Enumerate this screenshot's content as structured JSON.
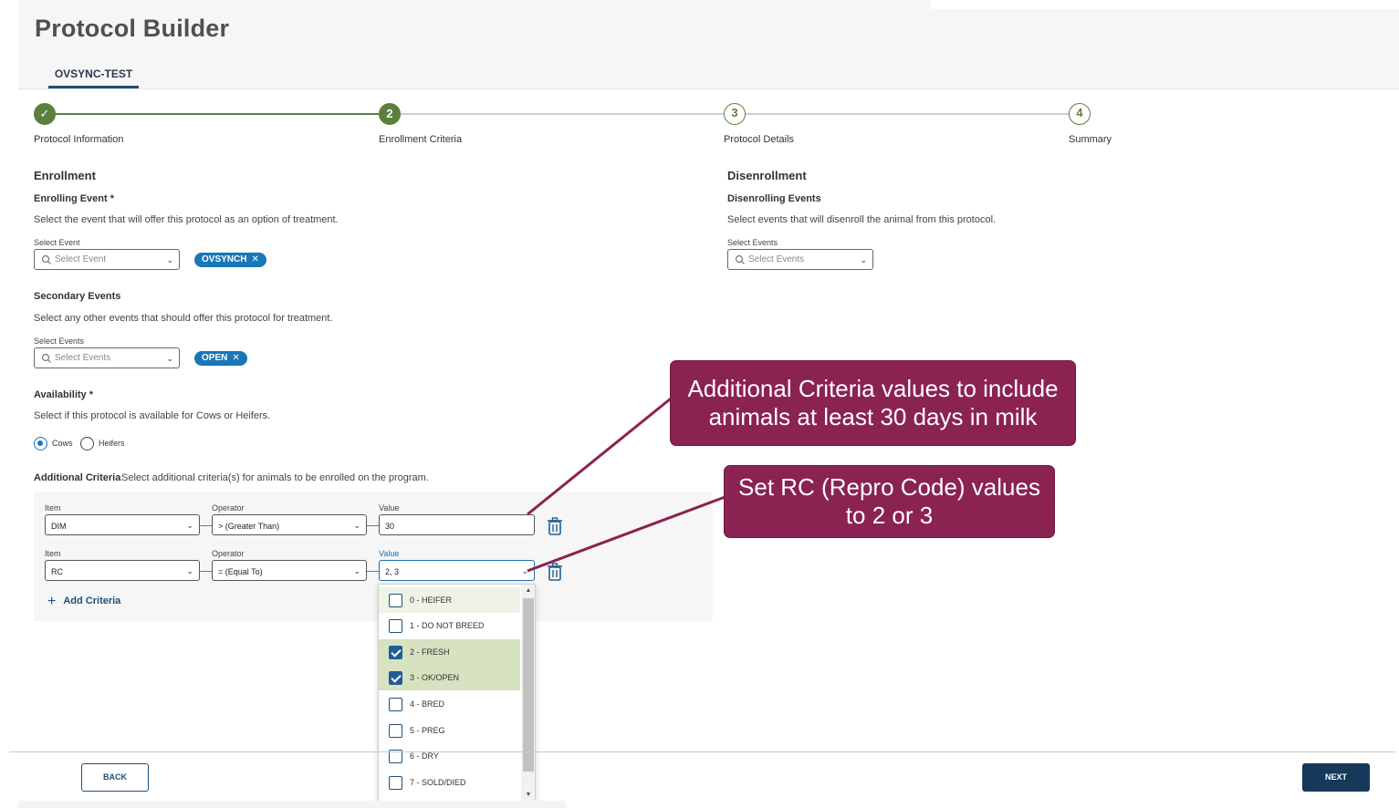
{
  "header": {
    "title": "Protocol Builder",
    "tab": "OVSYNC-TEST"
  },
  "stepper": {
    "steps": [
      {
        "number": "✓",
        "label": "Protocol Information"
      },
      {
        "number": "2",
        "label": "Enrollment Criteria"
      },
      {
        "number": "3",
        "label": "Protocol Details"
      },
      {
        "number": "4",
        "label": "Summary"
      }
    ]
  },
  "enrollment": {
    "title": "Enrollment",
    "enrolling_event": {
      "title": "Enrolling Event *",
      "desc": "Select the event that will offer this protocol as an option of treatment.",
      "label": "Select Event",
      "placeholder": "Select Event",
      "chip": "OVSYNCH"
    },
    "secondary_events": {
      "title": "Secondary Events",
      "desc": "Select any other events that should offer this protocol for treatment.",
      "label": "Select Events",
      "placeholder": "Select Events",
      "chip": "OPEN"
    },
    "availability": {
      "title": "Availability *",
      "desc": "Select if this protocol is available for Cows or Heifers.",
      "options": [
        "Cows",
        "Heifers"
      ],
      "selected": "Cows"
    }
  },
  "disenrollment": {
    "title": "Disenrollment",
    "field_title": "Disenrolling Events",
    "desc": "Select events that will disenroll the animal from this protocol.",
    "label": "Select Events",
    "placeholder": "Select Events"
  },
  "additional_criteria": {
    "title": "Additional Criteria",
    "desc": "Select additional criteria(s) for animals to be enrolled on the program.",
    "col_item": "Item",
    "col_operator": "Operator",
    "col_value": "Value",
    "rows": [
      {
        "item": "DIM",
        "operator": "> (Greater Than)",
        "value": "30"
      },
      {
        "item": "RC",
        "operator": "= (Equal To)",
        "value": "2, 3"
      }
    ],
    "add_label": "Add Criteria"
  },
  "rc_dropdown": {
    "options": [
      {
        "label": "0 - HEIFER",
        "checked": false
      },
      {
        "label": "1 - DO NOT BREED",
        "checked": false
      },
      {
        "label": "2 - FRESH",
        "checked": true
      },
      {
        "label": "3 - OK/OPEN",
        "checked": true
      },
      {
        "label": "4 - BRED",
        "checked": false
      },
      {
        "label": "5 - PREG",
        "checked": false
      },
      {
        "label": "6 - DRY",
        "checked": false
      },
      {
        "label": "7 - SOLD/DIED",
        "checked": false
      }
    ]
  },
  "footer": {
    "back": "BACK",
    "next": "NEXT"
  },
  "callouts": {
    "one": [
      "Additional Criteria values to include",
      "animals at least 30 days in milk"
    ],
    "two": [
      "Set RC (Repro Code) values",
      "to 2 or 3"
    ]
  },
  "colors": {
    "accent_green": "#5b7f3d",
    "chip_blue": "#1877b8",
    "navy": "#16395a",
    "callout": "#8a2252"
  }
}
